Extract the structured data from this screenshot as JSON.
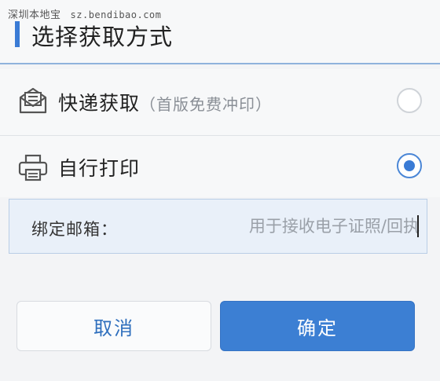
{
  "watermark": {
    "brand": "深圳本地宝",
    "domain": "sz.bendibao.com"
  },
  "dialog": {
    "title": "选择获取方式"
  },
  "options": [
    {
      "label": "快递获取",
      "note": "（首版免费冲印）",
      "icon": "envelope-icon",
      "selected": false
    },
    {
      "label": "自行打印",
      "note": "",
      "icon": "printer-icon",
      "selected": true
    }
  ],
  "email": {
    "label": "绑定邮箱：",
    "value": "",
    "placeholder": "用于接收电子证照/回执"
  },
  "buttons": {
    "cancel": "取消",
    "confirm": "确定"
  },
  "colors": {
    "accent": "#3a7bd5",
    "confirm_bg": "#3c7fd3",
    "field_bg": "#e9f0f9"
  }
}
